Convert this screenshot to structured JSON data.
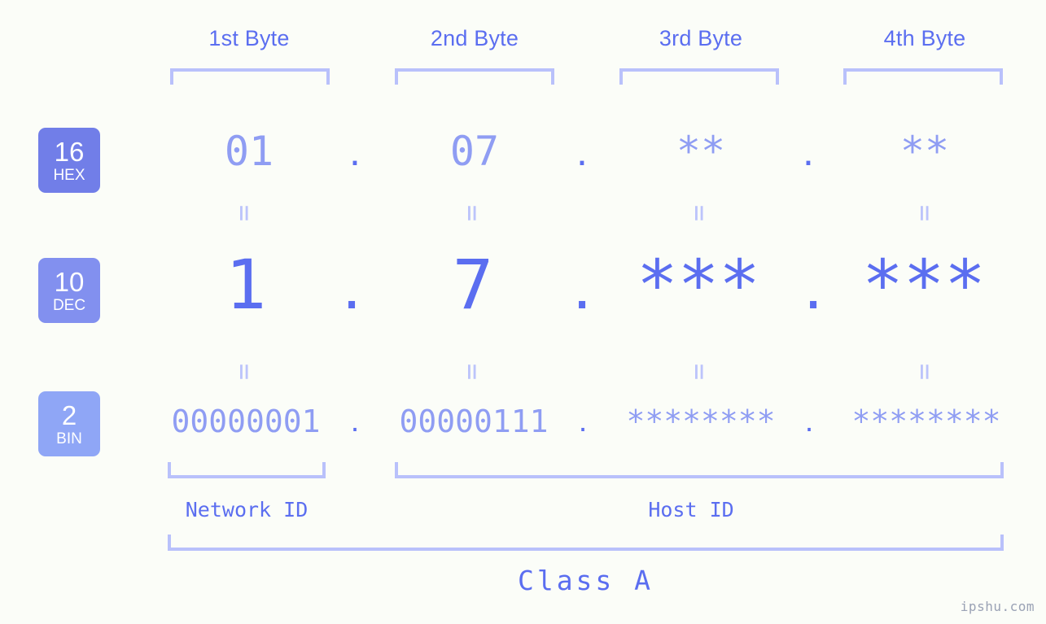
{
  "background": "#fbfdf8",
  "accent": "#5b6ef0",
  "accent_light": "#8f9df3",
  "accent_pale": "#b9c1fb",
  "headers": {
    "byte1": "1st Byte",
    "byte2": "2nd Byte",
    "byte3": "3rd Byte",
    "byte4": "4th Byte"
  },
  "bases": [
    {
      "number": "16",
      "name": "HEX",
      "color": "#717ee8"
    },
    {
      "number": "10",
      "name": "DEC",
      "color": "#8290ef"
    },
    {
      "number": "2",
      "name": "BIN",
      "color": "#8fa6f6"
    }
  ],
  "rows": {
    "hex": {
      "label_number": "16",
      "label_name": "HEX",
      "values": [
        "01",
        "07",
        "**",
        "**"
      ],
      "separator": "."
    },
    "dec": {
      "label_number": "10",
      "label_name": "DEC",
      "values": [
        "1",
        "7",
        "***",
        "***"
      ],
      "separator": "."
    },
    "bin": {
      "label_number": "2",
      "label_name": "BIN",
      "values": [
        "00000001",
        "00000111",
        "********",
        "********"
      ],
      "separator": "."
    }
  },
  "equals": {
    "symbol": "=",
    "hex_to_dec": [
      "=",
      "=",
      "=",
      "="
    ],
    "dec_to_bin": [
      "=",
      "=",
      "=",
      "="
    ]
  },
  "sections": {
    "network_id": "Network ID",
    "host_id": "Host ID",
    "class": "Class A"
  },
  "watermark": "ipshu.com"
}
